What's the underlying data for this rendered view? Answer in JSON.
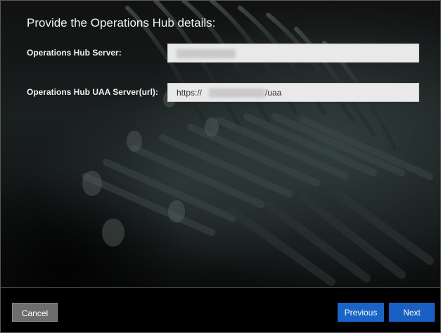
{
  "dialog": {
    "title": "Provide the Operations Hub details:"
  },
  "form": {
    "server_label": "Operations Hub Server:",
    "server_value": "",
    "uaa_label": "Operations Hub UAA Server(url):",
    "uaa_prefix": "https://",
    "uaa_suffix": "/uaa"
  },
  "footer": {
    "cancel_label": "Cancel",
    "previous_label": "Previous",
    "next_label": "Next"
  },
  "colors": {
    "primary_button": "#1a5fc4",
    "secondary_button": "#6d6d6d",
    "input_background": "#e9e9e9"
  }
}
